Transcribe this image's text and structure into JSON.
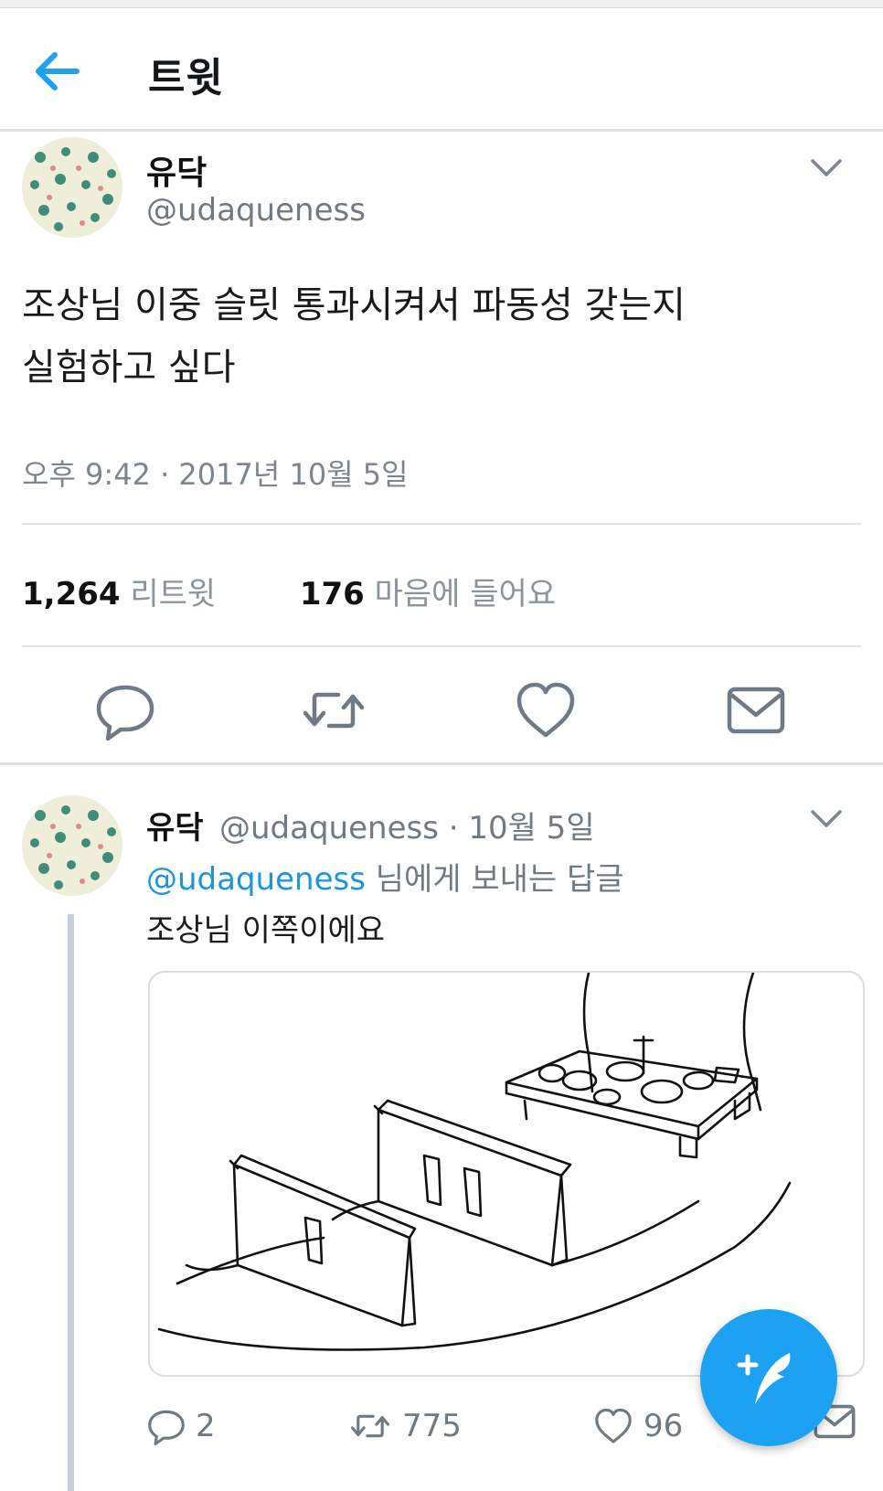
{
  "header": {
    "title": "트윗"
  },
  "tweet": {
    "name": "유닥",
    "handle": "@udaqueness",
    "text_line1": "조상님 이중 슬릿 통과시켜서 파동성 갖는지",
    "text_line2": "실험하고 싶다",
    "timestamp": "오후 9:42 · 2017년 10월 5일",
    "retweet_count": "1,264",
    "retweet_label": "리트윗",
    "like_count": "176",
    "like_label": "마음에 들어요"
  },
  "reply": {
    "name": "유닥",
    "meta": "@udaqueness · 10월 5일",
    "reply_to_handle": "@udaqueness",
    "reply_to_rest": " 님에게 보내는 답글",
    "text": "조상님 이쪽이에요",
    "reply_count": "2",
    "retweet_count": "775",
    "like_count": "96"
  },
  "colors": {
    "accent": "#1da1f2",
    "link": "#1b95e0",
    "muted": "#6f7a84"
  },
  "icons": [
    "back-arrow-icon",
    "chevron-down-icon",
    "reply-icon",
    "retweet-icon",
    "heart-icon",
    "mail-icon",
    "compose-quill-icon"
  ]
}
